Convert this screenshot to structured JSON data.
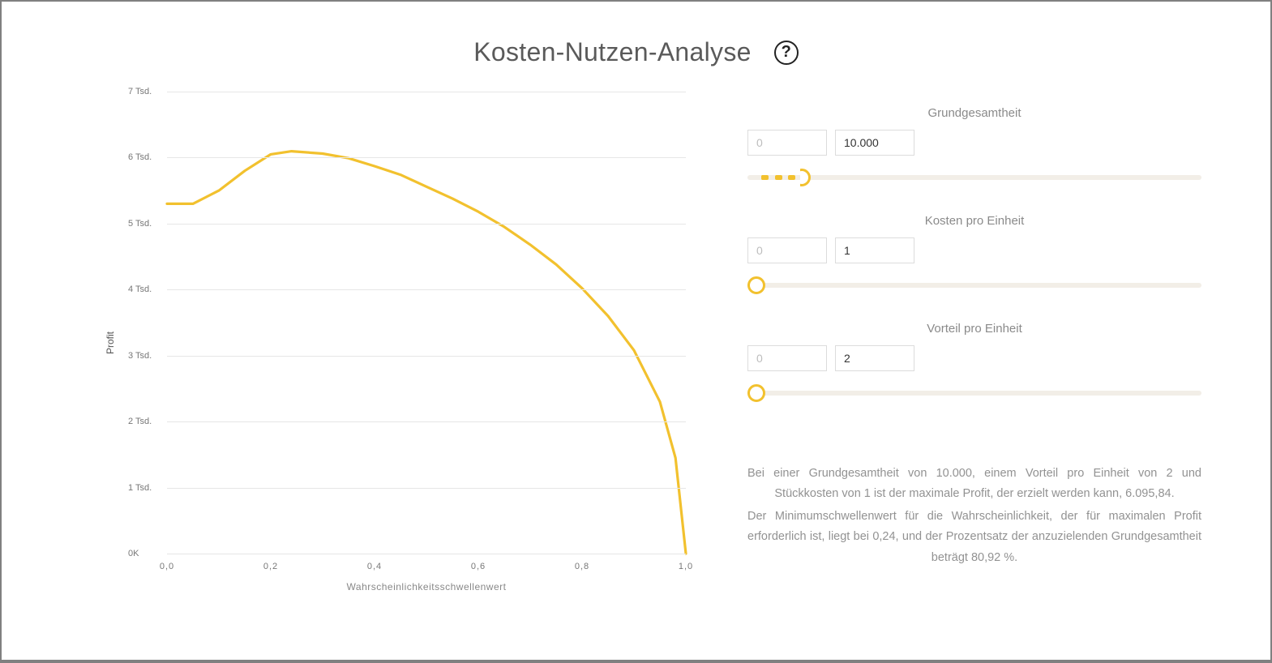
{
  "header": {
    "title": "Kosten-Nutzen-Analyse",
    "help_aria": "Hilfe"
  },
  "chart_data": {
    "type": "line",
    "title": "",
    "xlabel": "Wahrscheinlichkeitsschwellenwert",
    "ylabel": "Profit",
    "xlim": [
      0.0,
      1.0
    ],
    "ylim": [
      0,
      7000
    ],
    "x": [
      0.0,
      0.05,
      0.1,
      0.15,
      0.2,
      0.24,
      0.3,
      0.35,
      0.4,
      0.45,
      0.5,
      0.55,
      0.6,
      0.65,
      0.7,
      0.75,
      0.8,
      0.85,
      0.9,
      0.95,
      0.98,
      1.0
    ],
    "values": [
      5300,
      5300,
      5500,
      5800,
      6050,
      6095.84,
      6060,
      5990,
      5870,
      5740,
      5560,
      5380,
      5180,
      4950,
      4680,
      4380,
      4020,
      3600,
      3080,
      2300,
      1450,
      0
    ],
    "xticks": [
      0.0,
      0.2,
      0.4,
      0.6,
      0.8,
      1.0
    ],
    "xtick_labels": [
      "0,0",
      "0,2",
      "0,4",
      "0,6",
      "0,8",
      "1,0"
    ],
    "yticks": [
      0,
      1000,
      2000,
      3000,
      4000,
      5000,
      6000,
      7000
    ],
    "ytick_labels": [
      "0K",
      "1 Tsd.",
      "2 Tsd.",
      "3 Tsd.",
      "4 Tsd.",
      "5 Tsd.",
      "6 Tsd.",
      "7 Tsd."
    ]
  },
  "controls": {
    "population": {
      "label": "Grundgesamtheit",
      "min_placeholder": "0",
      "max_value": "10.000",
      "low_pct": 3,
      "high_pct": 12
    },
    "cost": {
      "label": "Kosten pro Einheit",
      "min_placeholder": "0",
      "value": "1",
      "pct": 2
    },
    "benefit": {
      "label": "Vorteil pro Einheit",
      "min_placeholder": "0",
      "value": "2",
      "pct": 2
    }
  },
  "summary": {
    "p1": "Bei einer Grundgesamtheit von 10.000, einem Vorteil pro Einheit von 2 und Stückkosten von 1 ist der maximale Profit, der erzielt werden kann, 6.095,84.",
    "p2": "Der Minimumschwellenwert für die Wahrscheinlichkeit, der für maximalen Profit erforderlich ist, liegt bei 0,24, und der Prozentsatz der anzuzielenden Grundgesamtheit beträgt 80,92 %."
  }
}
